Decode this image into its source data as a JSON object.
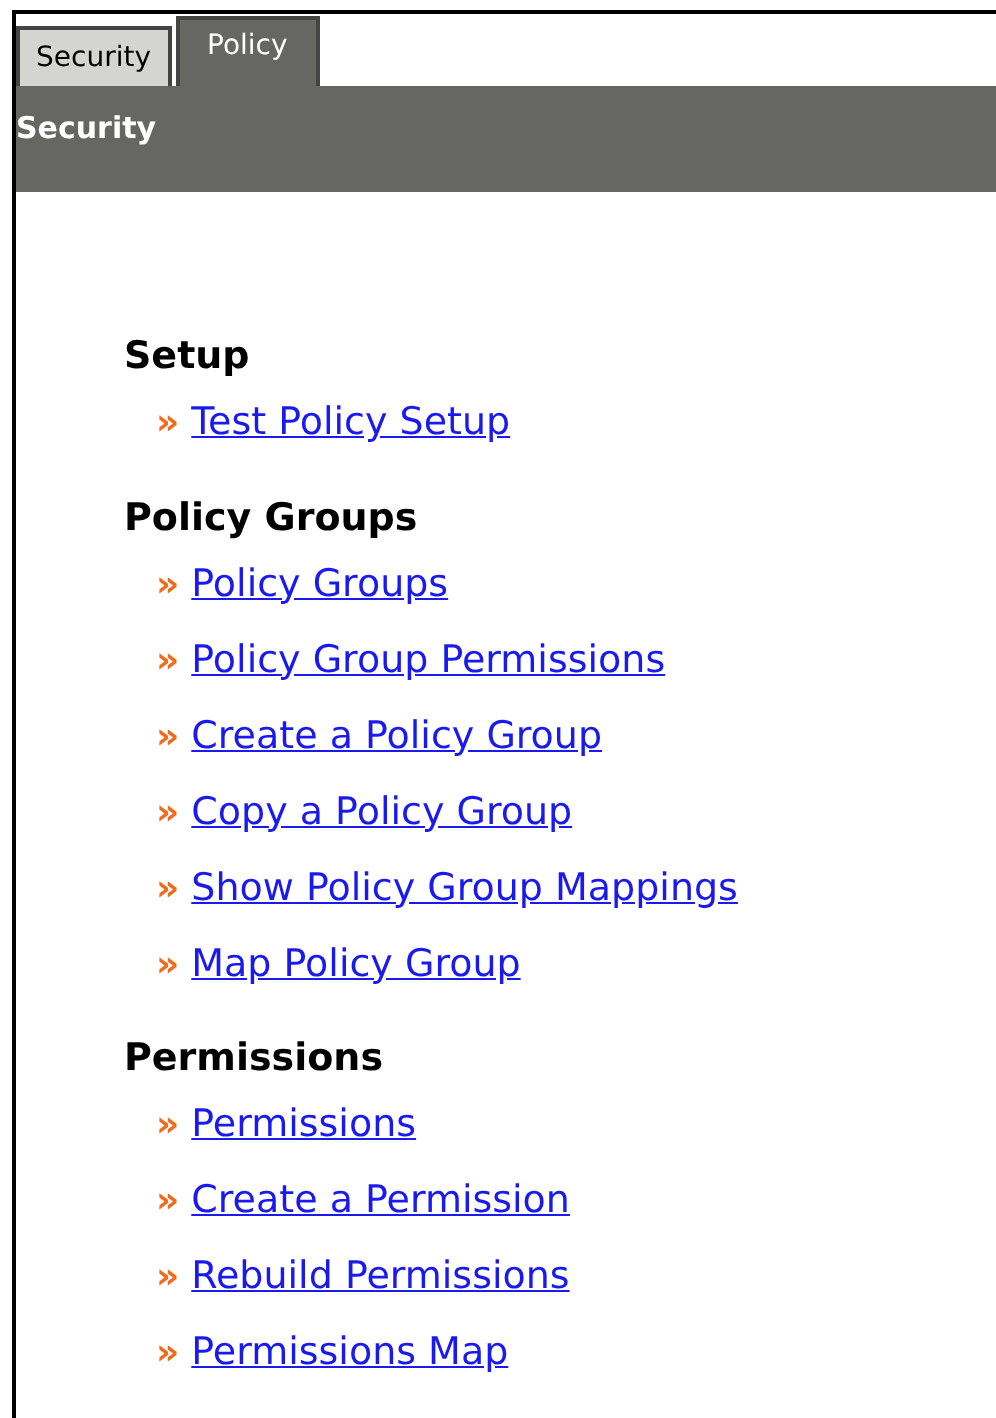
{
  "tabs": [
    {
      "label": "Security",
      "selected": false
    },
    {
      "label": "Policy",
      "selected": true
    }
  ],
  "header": {
    "title": "Security"
  },
  "sections": [
    {
      "heading": "Setup",
      "links": [
        {
          "marker": "»",
          "label": "Test Policy Setup"
        }
      ]
    },
    {
      "heading": "Policy Groups",
      "links": [
        {
          "marker": "»",
          "label": "Policy Groups"
        },
        {
          "marker": "»",
          "label": "Policy Group Permissions"
        },
        {
          "marker": "»",
          "label": "Create a Policy Group"
        },
        {
          "marker": "»",
          "label": "Copy a Policy Group"
        },
        {
          "marker": "»",
          "label": "Show Policy Group Mappings"
        },
        {
          "marker": "»",
          "label": "Map Policy Group"
        }
      ]
    },
    {
      "heading": "Permissions",
      "links": [
        {
          "marker": "»",
          "label": "Permissions"
        },
        {
          "marker": "»",
          "label": "Create a Permission"
        },
        {
          "marker": "»",
          "label": "Rebuild Permissions"
        },
        {
          "marker": "»",
          "label": "Permissions Map"
        }
      ]
    }
  ]
}
